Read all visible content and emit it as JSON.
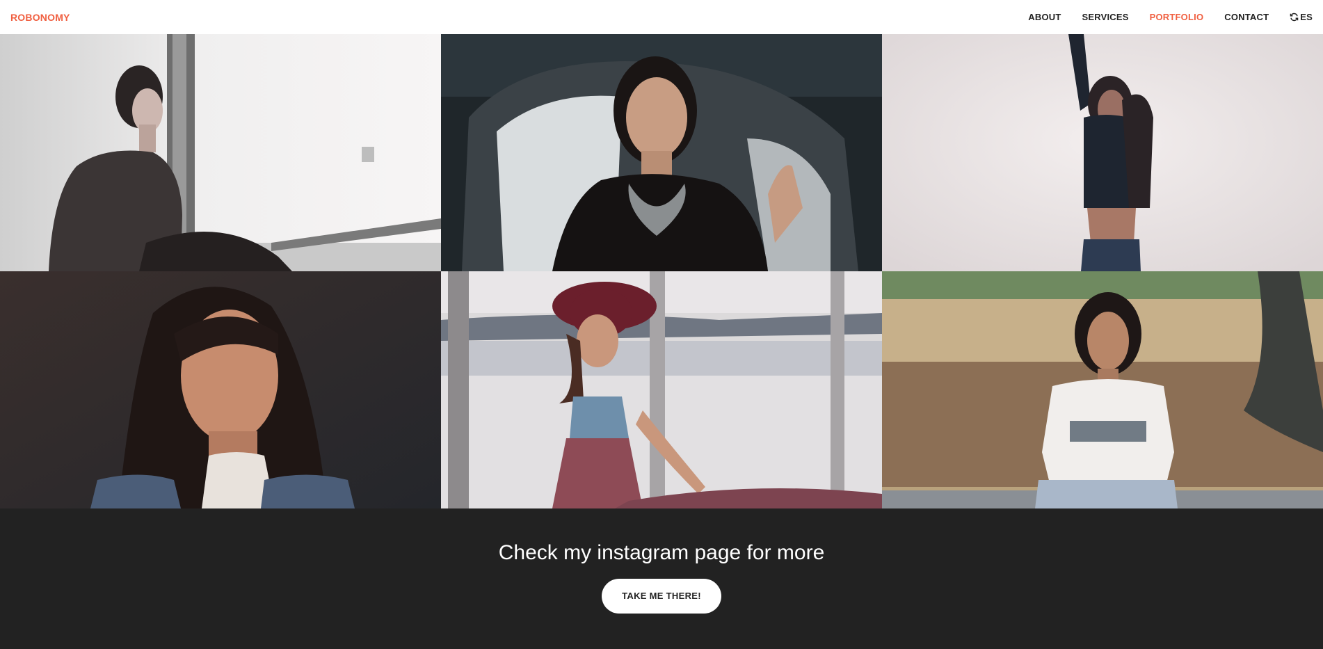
{
  "navbar": {
    "brand": "ROBONOMY",
    "links": [
      {
        "label": "ABOUT"
      },
      {
        "label": "SERVICES"
      },
      {
        "label": "PORTFOLIO"
      },
      {
        "label": "CONTACT"
      },
      {
        "label": "ES",
        "icon": "refresh-icon"
      }
    ],
    "active_link": "PORTFOLIO"
  },
  "portfolio": {
    "items": [
      {
        "subject": "woman-sitting-by-window-photo"
      },
      {
        "subject": "woman-in-chair-with-necklace-photo"
      },
      {
        "subject": "woman-arms-raised-photo"
      },
      {
        "subject": "woman-portrait-dark-background-photo"
      },
      {
        "subject": "woman-with-hat-by-window-photo"
      },
      {
        "subject": "woman-in-park-photo"
      }
    ]
  },
  "cta": {
    "heading": "Check my instagram page for more",
    "button_label": "TAKE ME THERE!"
  },
  "colors": {
    "accent": "#f05f40",
    "dark": "#222222",
    "white": "#ffffff"
  }
}
